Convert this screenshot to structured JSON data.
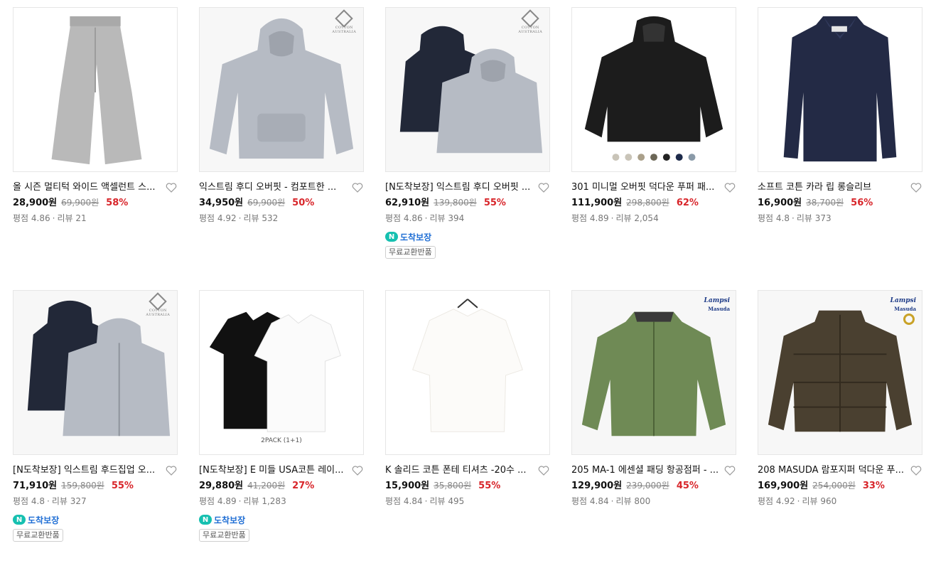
{
  "products": [
    {
      "name": "올 시즌 멀티턱 와이드 액셀런트 스...",
      "price": "28,900원",
      "original_price": "69,900원",
      "discount": "58%",
      "rating_label": "평점 4.86",
      "review_label": "리뷰 21",
      "n_delivery": "",
      "tag": "",
      "image": "gray-sweatpants"
    },
    {
      "name": "익스트림 후디 오버핏 - 컴포트한 ...",
      "price": "34,950원",
      "original_price": "69,900원",
      "discount": "50%",
      "rating_label": "평점 4.92",
      "review_label": "리뷰 532",
      "n_delivery": "",
      "tag": "",
      "image": "gray-hoodie",
      "brand_mark": "COTTON AUSTRALIA"
    },
    {
      "name": "[N도착보장] 익스트림 후디 오버핏 ...",
      "price": "62,910원",
      "original_price": "139,800원",
      "discount": "55%",
      "rating_label": "평점 4.86",
      "review_label": "리뷰 394",
      "n_delivery": "도착보장",
      "tag": "무료교환반품",
      "image": "navy-gray-hoodies",
      "brand_mark": "COTTON AUSTRALIA"
    },
    {
      "name": "301 미니멀 오버핏 덕다운 푸퍼 패...",
      "price": "111,900원",
      "original_price": "298,800원",
      "discount": "62%",
      "rating_label": "평점 4.89",
      "review_label": "리뷰 2,054",
      "n_delivery": "",
      "tag": "",
      "image": "black-puffer"
    },
    {
      "name": "소프트 코튼 카라 립 롱슬리브",
      "price": "16,900원",
      "original_price": "38,700원",
      "discount": "56%",
      "rating_label": "평점 4.8",
      "review_label": "리뷰 373",
      "n_delivery": "",
      "tag": "",
      "image": "navy-polo"
    },
    {
      "name": "[N도착보장] 익스트림 후드집업 오...",
      "price": "71,910원",
      "original_price": "159,800원",
      "discount": "55%",
      "rating_label": "평점 4.8",
      "review_label": "리뷰 327",
      "n_delivery": "도착보장",
      "tag": "무료교환반품",
      "image": "zip-hoodies",
      "brand_mark": "COTTON AUSTRALIA"
    },
    {
      "name": "[N도착보장] E 미들 USA코튼 레이...",
      "price": "29,880원",
      "original_price": "41,200원",
      "discount": "27%",
      "rating_label": "평점 4.89",
      "review_label": "리뷰 1,283",
      "n_delivery": "도착보장",
      "tag": "무료교환반품",
      "image": "tee-2pack",
      "pack_label": "2PACK (1+1)"
    },
    {
      "name": "K 솔리드 코튼 폰테 티셔츠 -20수 ...",
      "price": "15,900원",
      "original_price": "35,800원",
      "discount": "55%",
      "rating_label": "평점 4.84",
      "review_label": "리뷰 495",
      "n_delivery": "",
      "tag": "",
      "image": "white-tee"
    },
    {
      "name": "205 MA-1 에센셜 패딩 항공점퍼 - ...",
      "price": "129,900원",
      "original_price": "239,000원",
      "discount": "45%",
      "rating_label": "평점 4.84",
      "review_label": "리뷰 800",
      "n_delivery": "",
      "tag": "",
      "image": "green-ma1",
      "brand_mark": "Lampsi / Masuda"
    },
    {
      "name": "208 MASUDA 람포지퍼 덕다운 푸...",
      "price": "169,900원",
      "original_price": "254,000원",
      "discount": "33%",
      "rating_label": "평점 4.92",
      "review_label": "리뷰 960",
      "n_delivery": "",
      "tag": "",
      "image": "olive-puffer",
      "brand_mark": "Lampsi / Masuda"
    }
  ],
  "colors": {
    "discount": "#d8252a",
    "n_delivery": "#1f6ed4",
    "n_badge": "#16c0b0"
  },
  "icons": {
    "wishlist": "heart-outline-icon",
    "delivery": "n-delivery-icon"
  }
}
